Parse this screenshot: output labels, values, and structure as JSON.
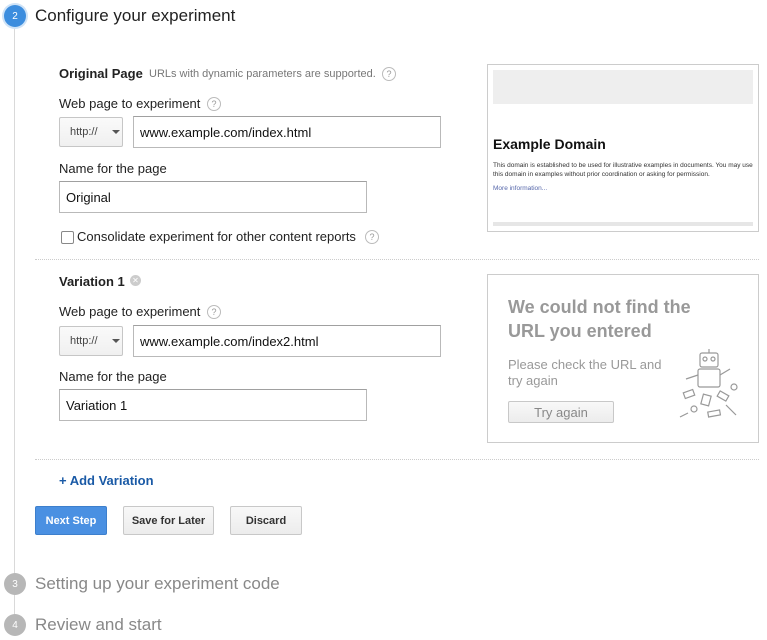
{
  "steps": [
    {
      "number": "2",
      "title": "Configure your experiment"
    },
    {
      "number": "3",
      "title": "Setting up your experiment code"
    },
    {
      "number": "4",
      "title": "Review and start"
    }
  ],
  "original": {
    "section_label": "Original Page",
    "hint": "URLs with dynamic parameters are supported.",
    "url_label": "Web page to experiment",
    "protocol": "http://",
    "url_value": "www.example.com/index.html",
    "name_label": "Name for the page",
    "name_value": "Original",
    "consolidate_label": "Consolidate experiment for other content reports",
    "preview": {
      "heading": "Example Domain",
      "body": "This domain is established to be used for illustrative examples in documents. You may use this domain in examples without prior coordination or asking for permission.",
      "link": "More information..."
    }
  },
  "variation": {
    "section_label": "Variation 1",
    "url_label": "Web page to experiment",
    "protocol": "http://",
    "url_value": "www.example.com/index2.html",
    "name_label": "Name for the page",
    "name_value": "Variation 1",
    "error": {
      "title": "We could not find the URL you entered",
      "message": "Please check the URL and try again",
      "button": "Try again"
    }
  },
  "add_variation_label": "+ Add Variation",
  "buttons": {
    "next": "Next Step",
    "save": "Save for Later",
    "discard": "Discard"
  },
  "help_icon": "?",
  "colors": {
    "accent": "#3c8dde",
    "primary_button": "#4a90e2",
    "link": "#1a5aa6"
  }
}
